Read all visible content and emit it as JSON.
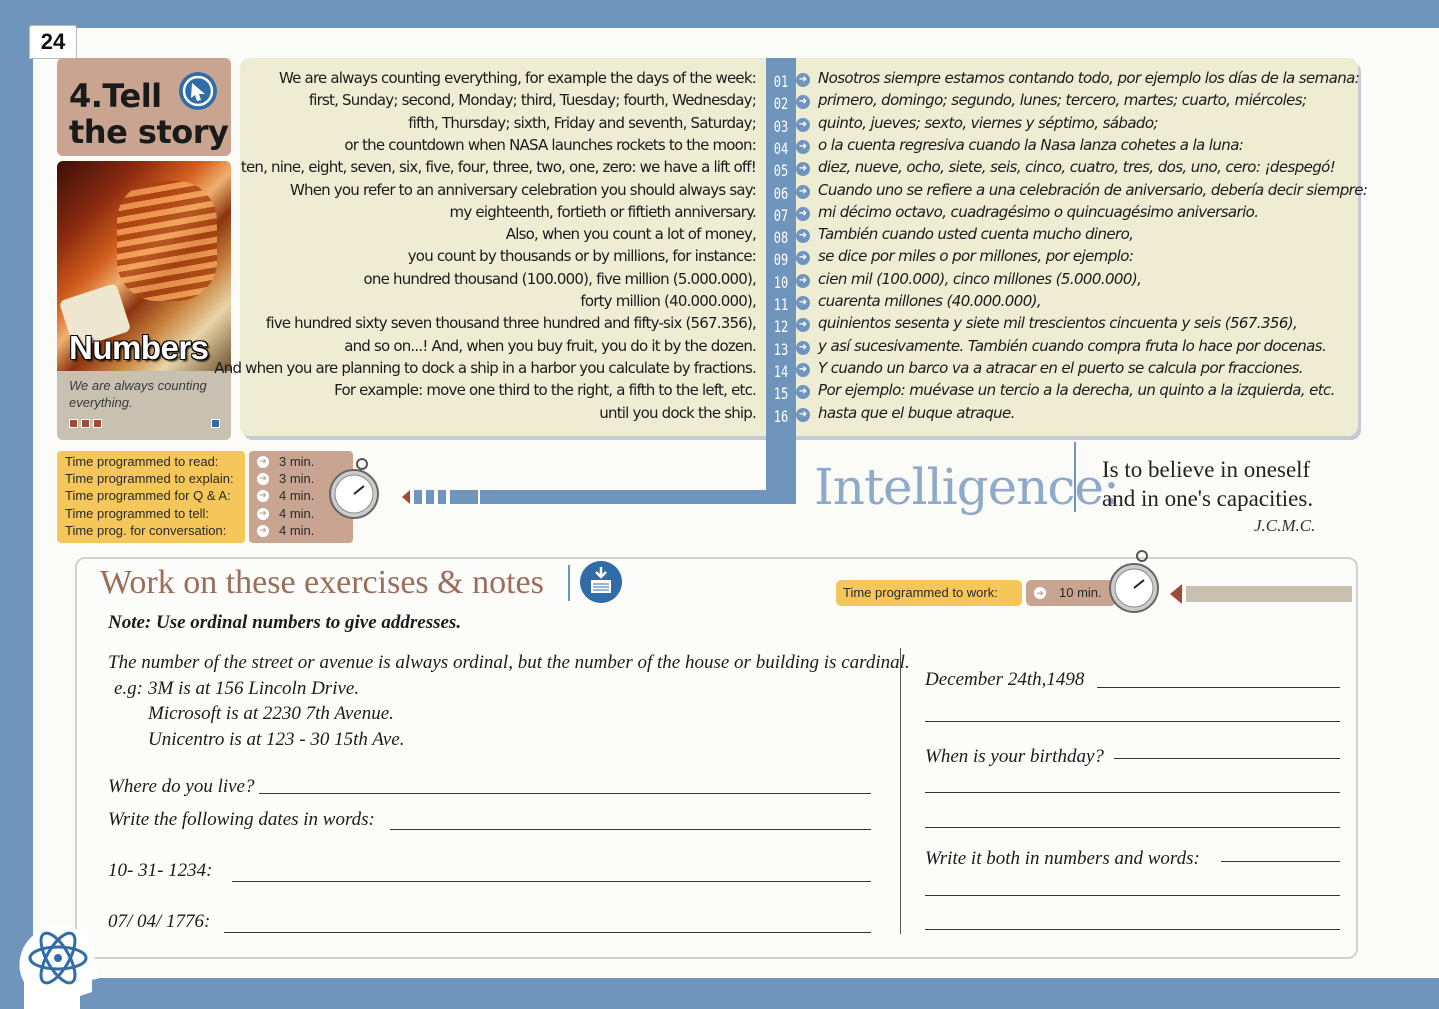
{
  "page_number": "24",
  "section": {
    "title_line1": "4.Tell",
    "title_line2": "the story"
  },
  "topic": {
    "title": "Numbers",
    "caption": "We are always counting everything."
  },
  "reading": {
    "english": [
      "We are always counting everything, for example the days of the week:",
      "first, Sunday; second, Monday; third, Tuesday; fourth, Wednesday;",
      "fifth, Thursday; sixth, Friday and seventh, Saturday;",
      "or the countdown when NASA launches rockets to the moon:",
      "ten, nine, eight, seven, six, five, four, three, two, one, zero: we have a lift off!",
      "When you refer to an anniversary celebration you should always say:",
      "my eighteenth, fortieth or fiftieth anniversary.",
      "Also, when you count a lot of money,",
      "you count by thousands or by millions, for instance:",
      "one hundred thousand (100.000), five million (5.000.000),",
      "forty million (40.000.000),",
      "five hundred sixty seven thousand three hundred and fifty-six (567.356),",
      "and so on...! And, when you buy fruit, you do it by the dozen.",
      "And when you are planning to dock a ship in a harbor you calculate by fractions.",
      "For example: move one third to the right, a fifth to the left, etc.",
      "until you dock the ship."
    ],
    "line_numbers": [
      "01",
      "02",
      "03",
      "04",
      "05",
      "06",
      "07",
      "08",
      "09",
      "10",
      "11",
      "12",
      "13",
      "14",
      "15",
      "16"
    ],
    "spanish": [
      "Nosotros siempre estamos contando todo, por ejemplo los días de la semana:",
      "primero, domingo; segundo, lunes; tercero, martes; cuarto, miércoles;",
      "quinto, jueves; sexto, viernes y séptimo, sábado;",
      "o la cuenta regresiva cuando la Nasa lanza cohetes a la luna:",
      "diez, nueve, ocho, siete, seis, cinco, cuatro, tres, dos, uno, cero: ¡despegó!",
      "Cuando uno se refiere a una celebración de aniversario, debería decir siempre:",
      "mi décimo octavo, cuadragésimo o quincuagésimo aniversario.",
      "También cuando usted cuenta mucho dinero,",
      "se dice por miles o por millones, por ejemplo:",
      "cien mil (100.000), cinco millones (5.000.000),",
      "cuarenta millones (40.000.000),",
      "quinientos sesenta y siete mil trescientos cincuenta y seis (567.356),",
      "y así sucesivamente. También cuando compra fruta lo hace por docenas.",
      "Y cuando un barco va a atracar en el puerto se calcula por fracciones.",
      "Por ejemplo: muévase un tercio a la derecha, un quinto a la izquierda, etc.",
      "hasta que el buque atraque."
    ]
  },
  "time_programmed": [
    {
      "label": "Time programmed to read:",
      "value": "3 min."
    },
    {
      "label": "Time programmed to explain:",
      "value": "3 min."
    },
    {
      "label": "Time programmed for Q & A:",
      "value": "4 min."
    },
    {
      "label": "Time programmed to tell:",
      "value": "4 min."
    },
    {
      "label": "Time prog. for conversation:",
      "value": "4 min."
    }
  ],
  "quote": {
    "word": "Intelligence:",
    "line1": "Is to believe in oneself",
    "line2": "and in one's capacities.",
    "author": "J.C.M.C."
  },
  "exercises": {
    "title": "Work on these exercises & notes",
    "work_time_label": "Time programmed to work:",
    "work_time_value": "10 min.",
    "note": "Note: Use ordinal numbers to give addresses.",
    "rule": "The number of the street or avenue is always ordinal, but the number of the house or building is cardinal.",
    "eg_prefix": "e.g:",
    "example1": "3M is at 156 Lincoln Drive.",
    "example2": "Microsoft is at 2230 7th Avenue.",
    "example3": "Unicentro is at 123 - 30 15th Ave.",
    "q_live": "Where do you live?",
    "q_dates": "Write the following dates in words:",
    "date1": "10- 31- 1234:",
    "date2": "07/ 04/ 1776:",
    "date3": "December 24th,1498",
    "q_birthday": "When is your birthday?",
    "q_both": "Write it both in numbers and words:"
  },
  "colors": {
    "frame": "#6f95bd",
    "reading_bg": "#eeecd3",
    "title_bg": "#c9a591",
    "time_bg": "#f5c65a"
  },
  "icons": [
    "tell-story-icon",
    "stopwatch-icon",
    "download-icon",
    "atom-head-icon"
  ]
}
